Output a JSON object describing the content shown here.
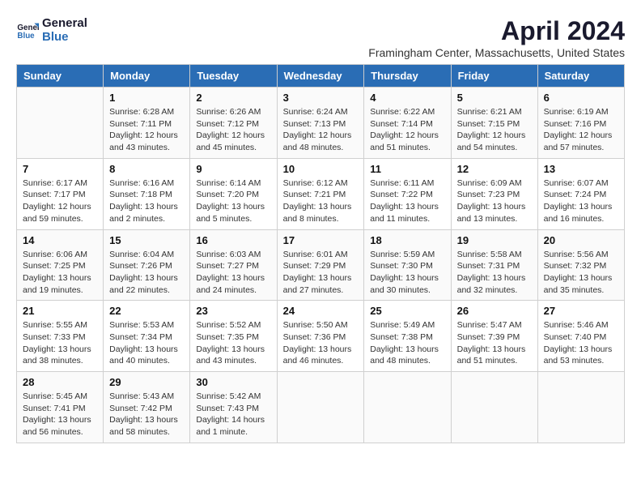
{
  "header": {
    "logo_line1": "General",
    "logo_line2": "Blue",
    "title": "April 2024",
    "subtitle": "Framingham Center, Massachusetts, United States"
  },
  "calendar": {
    "days_of_week": [
      "Sunday",
      "Monday",
      "Tuesday",
      "Wednesday",
      "Thursday",
      "Friday",
      "Saturday"
    ],
    "weeks": [
      [
        {
          "day": "",
          "info": ""
        },
        {
          "day": "1",
          "info": "Sunrise: 6:28 AM\nSunset: 7:11 PM\nDaylight: 12 hours\nand 43 minutes."
        },
        {
          "day": "2",
          "info": "Sunrise: 6:26 AM\nSunset: 7:12 PM\nDaylight: 12 hours\nand 45 minutes."
        },
        {
          "day": "3",
          "info": "Sunrise: 6:24 AM\nSunset: 7:13 PM\nDaylight: 12 hours\nand 48 minutes."
        },
        {
          "day": "4",
          "info": "Sunrise: 6:22 AM\nSunset: 7:14 PM\nDaylight: 12 hours\nand 51 minutes."
        },
        {
          "day": "5",
          "info": "Sunrise: 6:21 AM\nSunset: 7:15 PM\nDaylight: 12 hours\nand 54 minutes."
        },
        {
          "day": "6",
          "info": "Sunrise: 6:19 AM\nSunset: 7:16 PM\nDaylight: 12 hours\nand 57 minutes."
        }
      ],
      [
        {
          "day": "7",
          "info": "Sunrise: 6:17 AM\nSunset: 7:17 PM\nDaylight: 12 hours\nand 59 minutes."
        },
        {
          "day": "8",
          "info": "Sunrise: 6:16 AM\nSunset: 7:18 PM\nDaylight: 13 hours\nand 2 minutes."
        },
        {
          "day": "9",
          "info": "Sunrise: 6:14 AM\nSunset: 7:20 PM\nDaylight: 13 hours\nand 5 minutes."
        },
        {
          "day": "10",
          "info": "Sunrise: 6:12 AM\nSunset: 7:21 PM\nDaylight: 13 hours\nand 8 minutes."
        },
        {
          "day": "11",
          "info": "Sunrise: 6:11 AM\nSunset: 7:22 PM\nDaylight: 13 hours\nand 11 minutes."
        },
        {
          "day": "12",
          "info": "Sunrise: 6:09 AM\nSunset: 7:23 PM\nDaylight: 13 hours\nand 13 minutes."
        },
        {
          "day": "13",
          "info": "Sunrise: 6:07 AM\nSunset: 7:24 PM\nDaylight: 13 hours\nand 16 minutes."
        }
      ],
      [
        {
          "day": "14",
          "info": "Sunrise: 6:06 AM\nSunset: 7:25 PM\nDaylight: 13 hours\nand 19 minutes."
        },
        {
          "day": "15",
          "info": "Sunrise: 6:04 AM\nSunset: 7:26 PM\nDaylight: 13 hours\nand 22 minutes."
        },
        {
          "day": "16",
          "info": "Sunrise: 6:03 AM\nSunset: 7:27 PM\nDaylight: 13 hours\nand 24 minutes."
        },
        {
          "day": "17",
          "info": "Sunrise: 6:01 AM\nSunset: 7:29 PM\nDaylight: 13 hours\nand 27 minutes."
        },
        {
          "day": "18",
          "info": "Sunrise: 5:59 AM\nSunset: 7:30 PM\nDaylight: 13 hours\nand 30 minutes."
        },
        {
          "day": "19",
          "info": "Sunrise: 5:58 AM\nSunset: 7:31 PM\nDaylight: 13 hours\nand 32 minutes."
        },
        {
          "day": "20",
          "info": "Sunrise: 5:56 AM\nSunset: 7:32 PM\nDaylight: 13 hours\nand 35 minutes."
        }
      ],
      [
        {
          "day": "21",
          "info": "Sunrise: 5:55 AM\nSunset: 7:33 PM\nDaylight: 13 hours\nand 38 minutes."
        },
        {
          "day": "22",
          "info": "Sunrise: 5:53 AM\nSunset: 7:34 PM\nDaylight: 13 hours\nand 40 minutes."
        },
        {
          "day": "23",
          "info": "Sunrise: 5:52 AM\nSunset: 7:35 PM\nDaylight: 13 hours\nand 43 minutes."
        },
        {
          "day": "24",
          "info": "Sunrise: 5:50 AM\nSunset: 7:36 PM\nDaylight: 13 hours\nand 46 minutes."
        },
        {
          "day": "25",
          "info": "Sunrise: 5:49 AM\nSunset: 7:38 PM\nDaylight: 13 hours\nand 48 minutes."
        },
        {
          "day": "26",
          "info": "Sunrise: 5:47 AM\nSunset: 7:39 PM\nDaylight: 13 hours\nand 51 minutes."
        },
        {
          "day": "27",
          "info": "Sunrise: 5:46 AM\nSunset: 7:40 PM\nDaylight: 13 hours\nand 53 minutes."
        }
      ],
      [
        {
          "day": "28",
          "info": "Sunrise: 5:45 AM\nSunset: 7:41 PM\nDaylight: 13 hours\nand 56 minutes."
        },
        {
          "day": "29",
          "info": "Sunrise: 5:43 AM\nSunset: 7:42 PM\nDaylight: 13 hours\nand 58 minutes."
        },
        {
          "day": "30",
          "info": "Sunrise: 5:42 AM\nSunset: 7:43 PM\nDaylight: 14 hours\nand 1 minute."
        },
        {
          "day": "",
          "info": ""
        },
        {
          "day": "",
          "info": ""
        },
        {
          "day": "",
          "info": ""
        },
        {
          "day": "",
          "info": ""
        }
      ]
    ]
  }
}
